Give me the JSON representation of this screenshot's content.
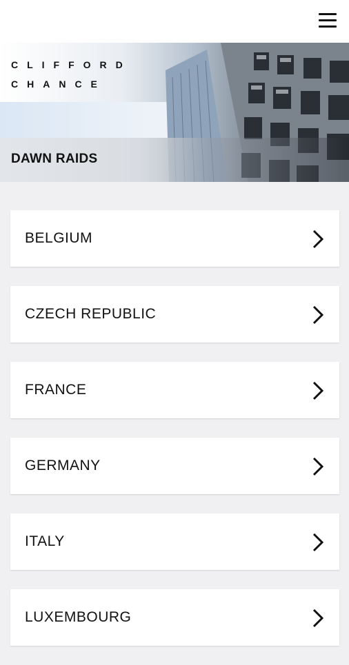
{
  "header": {
    "menu_icon": "hamburger-menu-icon"
  },
  "hero": {
    "brand_line1": "CLIFFORD",
    "brand_line2": "CHANCE",
    "title": "DAWN RAIDS"
  },
  "countries": [
    {
      "label": "BELGIUM",
      "icon": "chevron-right-icon"
    },
    {
      "label": "CZECH REPUBLIC",
      "icon": "chevron-right-icon"
    },
    {
      "label": "FRANCE",
      "icon": "chevron-right-icon"
    },
    {
      "label": "GERMANY",
      "icon": "chevron-right-icon"
    },
    {
      "label": "ITALY",
      "icon": "chevron-right-icon"
    },
    {
      "label": "LUXEMBOURG",
      "icon": "chevron-right-icon"
    }
  ],
  "colors": {
    "background": "#f0f0f2",
    "card": "#ffffff",
    "text": "#111111"
  }
}
